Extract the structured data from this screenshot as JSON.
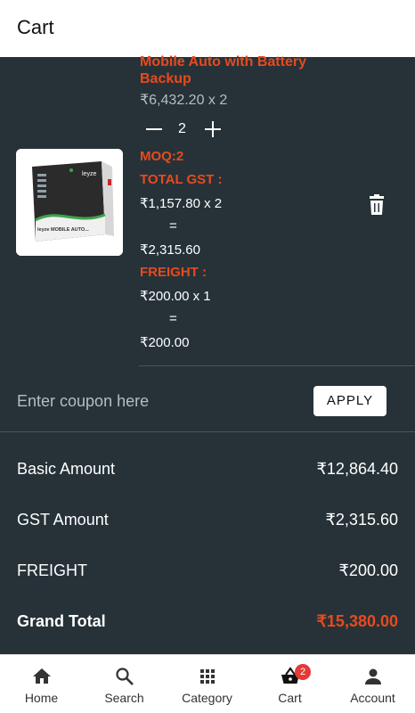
{
  "appbar": {
    "title": "Cart"
  },
  "item": {
    "title": "Mobile Auto with Battery Backup",
    "unit_price": "₹6,432.20 x 2",
    "quantity": "2",
    "moq": "MOQ:2",
    "gst_label": "TOTAL GST :",
    "gst_calc": "₹1,157.80 x 2",
    "gst_eq": "=",
    "gst_total": "₹2,315.60",
    "freight_label": "FREIGHT :",
    "freight_calc": "₹200.00 x 1",
    "freight_eq": "=",
    "freight_total": "₹200.00",
    "thumb_brand": "leyze",
    "thumb_text": "leyze MOBILE AUTO..."
  },
  "coupon": {
    "placeholder": "Enter coupon here",
    "apply_label": "APPLY"
  },
  "summary": {
    "basic_label": "Basic Amount",
    "basic_value": "₹12,864.40",
    "gst_label": "GST Amount",
    "gst_value": "₹2,315.60",
    "freight_label": "FREIGHT",
    "freight_value": "₹200.00",
    "total_label": "Grand Total",
    "total_value": "₹15,380.00"
  },
  "nav": {
    "items": [
      {
        "label": "Home",
        "icon": "home-icon"
      },
      {
        "label": "Search",
        "icon": "search-icon"
      },
      {
        "label": "Category",
        "icon": "grid-icon"
      },
      {
        "label": "Cart",
        "icon": "basket-icon",
        "badge": "2"
      },
      {
        "label": "Account",
        "icon": "person-icon"
      }
    ]
  },
  "colors": {
    "accent": "#e84a1e",
    "background": "#263238"
  }
}
